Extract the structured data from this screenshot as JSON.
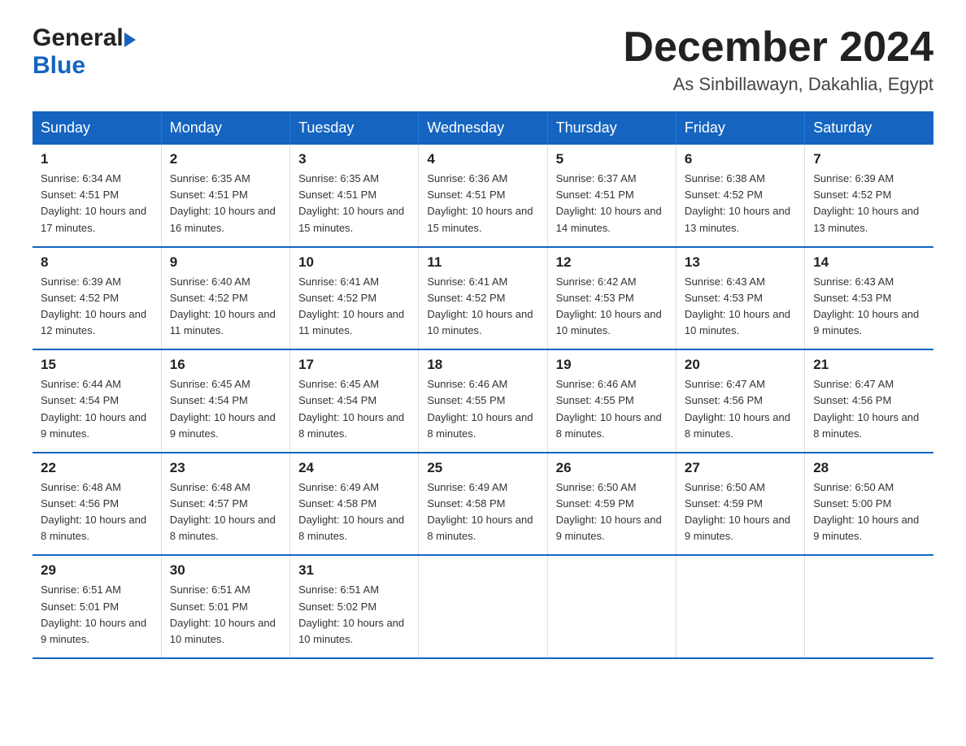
{
  "header": {
    "logo_general": "General",
    "logo_blue": "Blue",
    "month_title": "December 2024",
    "location": "As Sinbillawayn, Dakahlia, Egypt"
  },
  "days_of_week": [
    "Sunday",
    "Monday",
    "Tuesday",
    "Wednesday",
    "Thursday",
    "Friday",
    "Saturday"
  ],
  "weeks": [
    [
      {
        "day": "1",
        "sunrise": "6:34 AM",
        "sunset": "4:51 PM",
        "daylight": "10 hours and 17 minutes."
      },
      {
        "day": "2",
        "sunrise": "6:35 AM",
        "sunset": "4:51 PM",
        "daylight": "10 hours and 16 minutes."
      },
      {
        "day": "3",
        "sunrise": "6:35 AM",
        "sunset": "4:51 PM",
        "daylight": "10 hours and 15 minutes."
      },
      {
        "day": "4",
        "sunrise": "6:36 AM",
        "sunset": "4:51 PM",
        "daylight": "10 hours and 15 minutes."
      },
      {
        "day": "5",
        "sunrise": "6:37 AM",
        "sunset": "4:51 PM",
        "daylight": "10 hours and 14 minutes."
      },
      {
        "day": "6",
        "sunrise": "6:38 AM",
        "sunset": "4:52 PM",
        "daylight": "10 hours and 13 minutes."
      },
      {
        "day": "7",
        "sunrise": "6:39 AM",
        "sunset": "4:52 PM",
        "daylight": "10 hours and 13 minutes."
      }
    ],
    [
      {
        "day": "8",
        "sunrise": "6:39 AM",
        "sunset": "4:52 PM",
        "daylight": "10 hours and 12 minutes."
      },
      {
        "day": "9",
        "sunrise": "6:40 AM",
        "sunset": "4:52 PM",
        "daylight": "10 hours and 11 minutes."
      },
      {
        "day": "10",
        "sunrise": "6:41 AM",
        "sunset": "4:52 PM",
        "daylight": "10 hours and 11 minutes."
      },
      {
        "day": "11",
        "sunrise": "6:41 AM",
        "sunset": "4:52 PM",
        "daylight": "10 hours and 10 minutes."
      },
      {
        "day": "12",
        "sunrise": "6:42 AM",
        "sunset": "4:53 PM",
        "daylight": "10 hours and 10 minutes."
      },
      {
        "day": "13",
        "sunrise": "6:43 AM",
        "sunset": "4:53 PM",
        "daylight": "10 hours and 10 minutes."
      },
      {
        "day": "14",
        "sunrise": "6:43 AM",
        "sunset": "4:53 PM",
        "daylight": "10 hours and 9 minutes."
      }
    ],
    [
      {
        "day": "15",
        "sunrise": "6:44 AM",
        "sunset": "4:54 PM",
        "daylight": "10 hours and 9 minutes."
      },
      {
        "day": "16",
        "sunrise": "6:45 AM",
        "sunset": "4:54 PM",
        "daylight": "10 hours and 9 minutes."
      },
      {
        "day": "17",
        "sunrise": "6:45 AM",
        "sunset": "4:54 PM",
        "daylight": "10 hours and 8 minutes."
      },
      {
        "day": "18",
        "sunrise": "6:46 AM",
        "sunset": "4:55 PM",
        "daylight": "10 hours and 8 minutes."
      },
      {
        "day": "19",
        "sunrise": "6:46 AM",
        "sunset": "4:55 PM",
        "daylight": "10 hours and 8 minutes."
      },
      {
        "day": "20",
        "sunrise": "6:47 AM",
        "sunset": "4:56 PM",
        "daylight": "10 hours and 8 minutes."
      },
      {
        "day": "21",
        "sunrise": "6:47 AM",
        "sunset": "4:56 PM",
        "daylight": "10 hours and 8 minutes."
      }
    ],
    [
      {
        "day": "22",
        "sunrise": "6:48 AM",
        "sunset": "4:56 PM",
        "daylight": "10 hours and 8 minutes."
      },
      {
        "day": "23",
        "sunrise": "6:48 AM",
        "sunset": "4:57 PM",
        "daylight": "10 hours and 8 minutes."
      },
      {
        "day": "24",
        "sunrise": "6:49 AM",
        "sunset": "4:58 PM",
        "daylight": "10 hours and 8 minutes."
      },
      {
        "day": "25",
        "sunrise": "6:49 AM",
        "sunset": "4:58 PM",
        "daylight": "10 hours and 8 minutes."
      },
      {
        "day": "26",
        "sunrise": "6:50 AM",
        "sunset": "4:59 PM",
        "daylight": "10 hours and 9 minutes."
      },
      {
        "day": "27",
        "sunrise": "6:50 AM",
        "sunset": "4:59 PM",
        "daylight": "10 hours and 9 minutes."
      },
      {
        "day": "28",
        "sunrise": "6:50 AM",
        "sunset": "5:00 PM",
        "daylight": "10 hours and 9 minutes."
      }
    ],
    [
      {
        "day": "29",
        "sunrise": "6:51 AM",
        "sunset": "5:01 PM",
        "daylight": "10 hours and 9 minutes."
      },
      {
        "day": "30",
        "sunrise": "6:51 AM",
        "sunset": "5:01 PM",
        "daylight": "10 hours and 10 minutes."
      },
      {
        "day": "31",
        "sunrise": "6:51 AM",
        "sunset": "5:02 PM",
        "daylight": "10 hours and 10 minutes."
      },
      null,
      null,
      null,
      null
    ]
  ],
  "labels": {
    "sunrise": "Sunrise:",
    "sunset": "Sunset:",
    "daylight": "Daylight:"
  }
}
